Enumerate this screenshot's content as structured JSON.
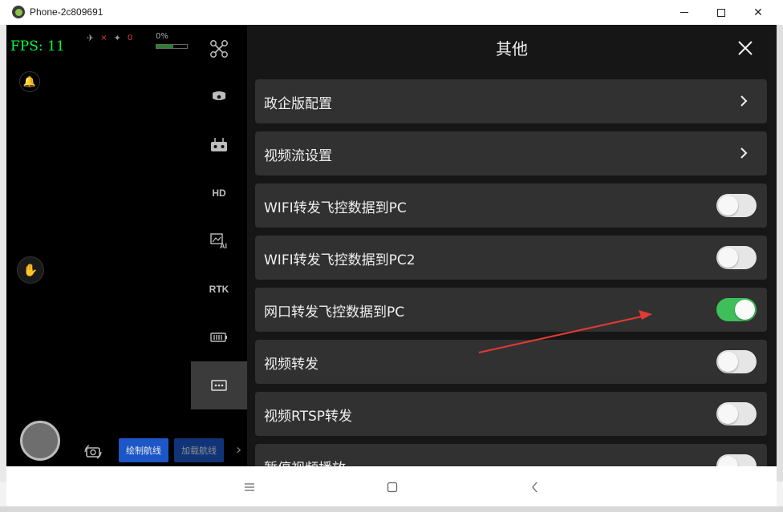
{
  "window": {
    "title": "Phone-2c809691",
    "minimize_glyph": "",
    "maximize_glyph": "",
    "close_glyph": "✕"
  },
  "camera": {
    "fps_label": "FPS: 11",
    "signal_x": "×",
    "gps_count": "0",
    "battery_percent": "0%",
    "route_buttons": [
      "绘制航线",
      "加载航线"
    ]
  },
  "sidebar": {
    "tabs": [
      {
        "id": "drone",
        "icon": "drone-icon",
        "text": ""
      },
      {
        "id": "gimbal",
        "icon": "gimbal-camera-icon",
        "text": ""
      },
      {
        "id": "remote",
        "icon": "remote-controller-icon",
        "text": ""
      },
      {
        "id": "hd",
        "icon": "hd-icon",
        "text": "HD"
      },
      {
        "id": "ai",
        "icon": "ai-image-icon",
        "text": ""
      },
      {
        "id": "rtk",
        "icon": "rtk-icon",
        "text": "RTK"
      },
      {
        "id": "battery",
        "icon": "battery-icon",
        "text": ""
      },
      {
        "id": "other",
        "icon": "more-icon",
        "text": "",
        "active": true
      }
    ]
  },
  "panel": {
    "title": "其他",
    "rows": [
      {
        "label": "政企版配置",
        "type": "link"
      },
      {
        "label": "视频流设置",
        "type": "link"
      },
      {
        "label": "WIFI转发飞控数据到PC",
        "type": "toggle",
        "on": false
      },
      {
        "label": "WIFI转发飞控数据到PC2",
        "type": "toggle",
        "on": false
      },
      {
        "label": "网口转发飞控数据到PC",
        "type": "toggle",
        "on": true
      },
      {
        "label": "视频转发",
        "type": "toggle",
        "on": false
      },
      {
        "label": "视频RTSP转发",
        "type": "toggle",
        "on": false
      },
      {
        "label": "暂停视频播放",
        "type": "toggle",
        "on": false
      }
    ]
  },
  "colors": {
    "toggle_on": "#3fbf5a",
    "toggle_off": "#e6e6e6",
    "annotation_arrow": "#e53935",
    "fps_text": "#00ff3b"
  }
}
